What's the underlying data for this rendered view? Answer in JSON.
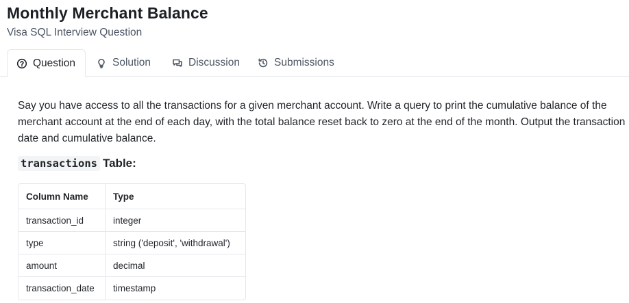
{
  "header": {
    "title": "Monthly Merchant Balance",
    "subtitle": "Visa SQL Interview Question"
  },
  "tabs": [
    {
      "label": "Question",
      "icon": "question-circle-icon",
      "active": true
    },
    {
      "label": "Solution",
      "icon": "lightbulb-icon",
      "active": false
    },
    {
      "label": "Discussion",
      "icon": "chat-bubbles-icon",
      "active": false
    },
    {
      "label": "Submissions",
      "icon": "history-icon",
      "active": false
    }
  ],
  "question": {
    "description": "Say you have access to all the transactions for a given merchant account. Write a query to print the cumulative balance of the merchant account at the end of each day, with the total balance reset back to zero at the end of the month. Output the transaction date and cumulative balance.",
    "table_name": "transactions",
    "table_suffix": "Table:",
    "columns_header": [
      "Column Name",
      "Type"
    ],
    "columns": [
      [
        "transaction_id",
        "integer"
      ],
      [
        "type",
        "string ('deposit', 'withdrawal')"
      ],
      [
        "amount",
        "decimal"
      ],
      [
        "transaction_date",
        "timestamp"
      ]
    ]
  }
}
